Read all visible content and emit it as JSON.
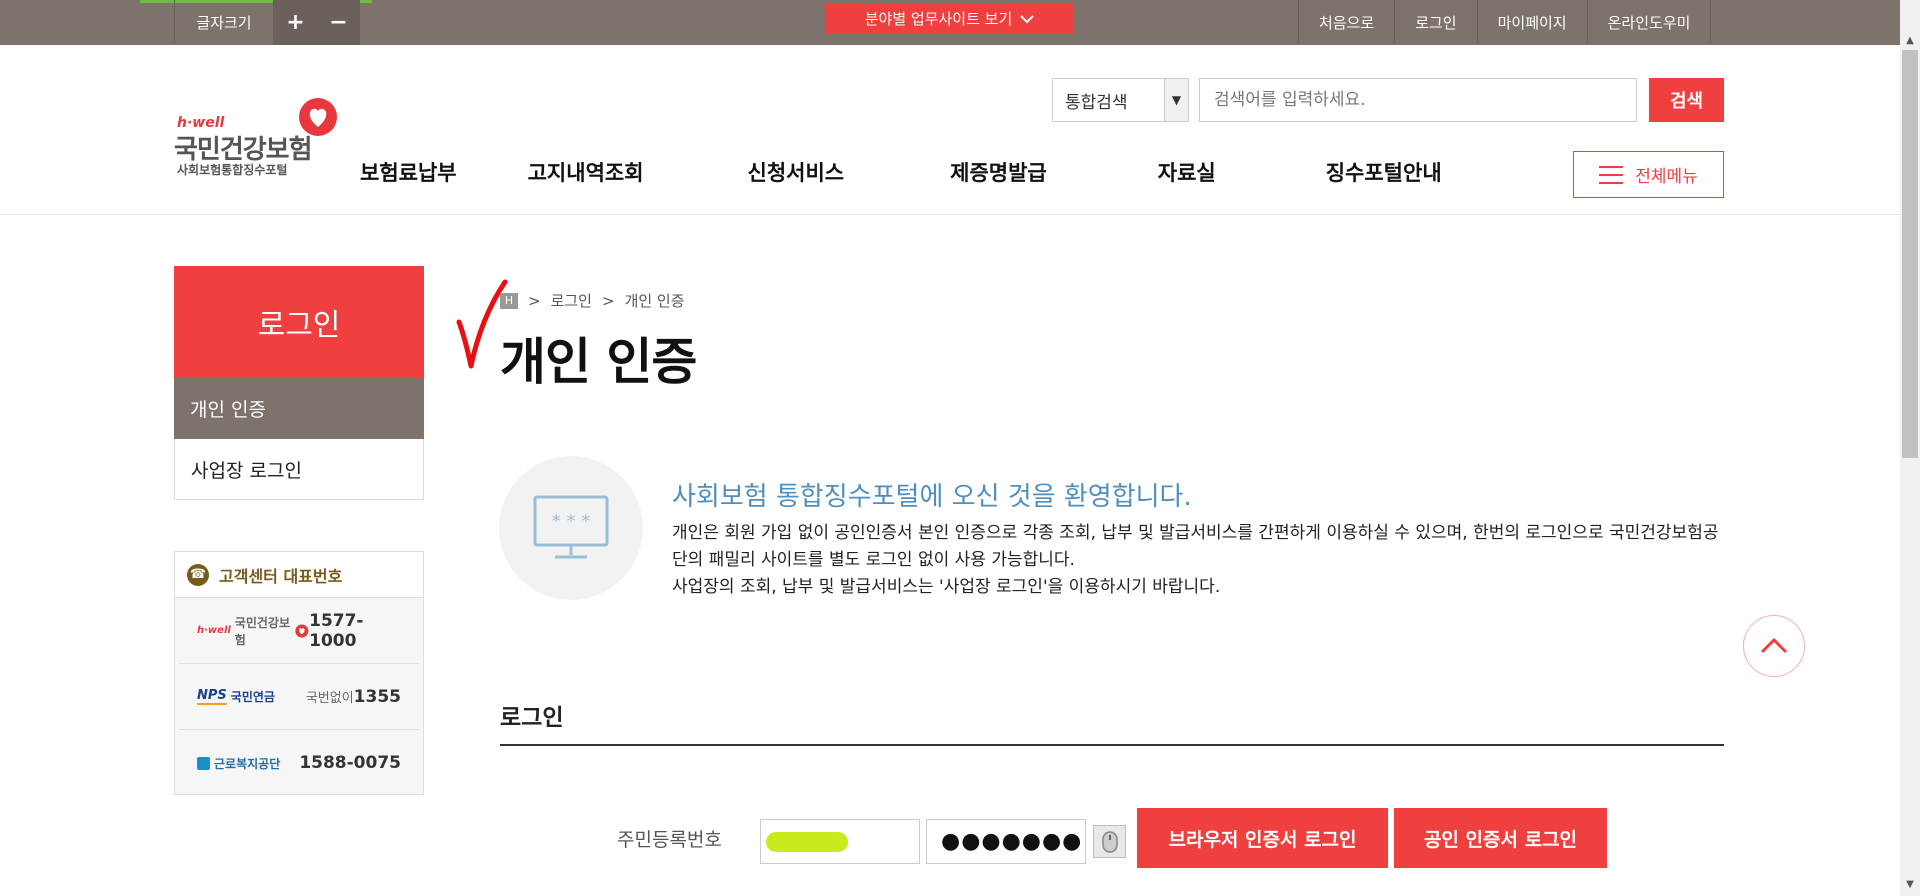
{
  "topbar": {
    "font_size_label": "글자크기",
    "font_plus": "+",
    "font_minus": "−",
    "site_dropdown_label": "분야별 업무사이트 보기",
    "links": [
      "처음으로",
      "로그인",
      "마이페이지",
      "온라인도우미"
    ]
  },
  "logo": {
    "brand": "h·well",
    "name": "국민건강보험",
    "sub": "사회보험통합징수포털"
  },
  "search": {
    "scope": "통합검색",
    "placeholder": "검색어를 입력하세요.",
    "button": "검색"
  },
  "gnb": {
    "items": [
      "보험료납부",
      "고지내역조회",
      "신청서비스",
      "제증명발급",
      "자료실",
      "징수포털안내"
    ],
    "all_menu": "전체메뉴"
  },
  "sidebar": {
    "title": "로그인",
    "items": [
      "개인 인증",
      "사업장 로그인"
    ],
    "cs_title": "고객센터 대표번호",
    "cs_rows": [
      {
        "org": "국민건강보험",
        "org_brand": "h·well",
        "prefix": "",
        "number": "1577-1000"
      },
      {
        "org": "국민연금",
        "org_brand": "NPS",
        "prefix": "국번없이",
        "number": "1355"
      },
      {
        "org": "근로복지공단",
        "org_brand": "",
        "prefix": "",
        "number": "1588-0075"
      }
    ]
  },
  "breadcrumb": {
    "home": "H",
    "items": [
      "로그인",
      "개인 인증"
    ]
  },
  "main": {
    "title": "개인 인증",
    "welcome": "사회보험 통합징수포털에 오신 것을 환영합니다.",
    "intro_line1": "개인은 회원 가입 없이 공인인증서 본인 인증으로 각종 조회, 납부 및 발급서비스를 간편하게 이용하실 수 있으며, 한번의 로그인으로 국민건강보험공단의 패밀리 사이트를 별도 로그인 없이 사용 가능합니다.",
    "intro_line2": "사업장의 조회, 납부 및 발급서비스는 '사업장 로그인'을 이용하시기 바랍니다.",
    "section_title": "로그인",
    "ssn_label": "주민등록번호",
    "ssn_back": "●●●●●●●",
    "btn_browser": "브라우저 인증서 로그인",
    "btn_cert": "공인 인증서 로그인"
  },
  "colors": {
    "brand_red": "#ef3f3f",
    "topbar_brown": "#7d726c",
    "welcome_blue": "#4f8fc0",
    "highlight_green": "#c6ec1e"
  },
  "icons": [
    "chevron-down-icon",
    "hamburger-icon",
    "phone-icon",
    "monitor-password-icon",
    "mouse-icon",
    "chevron-up-icon",
    "heart-logo-icon"
  ]
}
